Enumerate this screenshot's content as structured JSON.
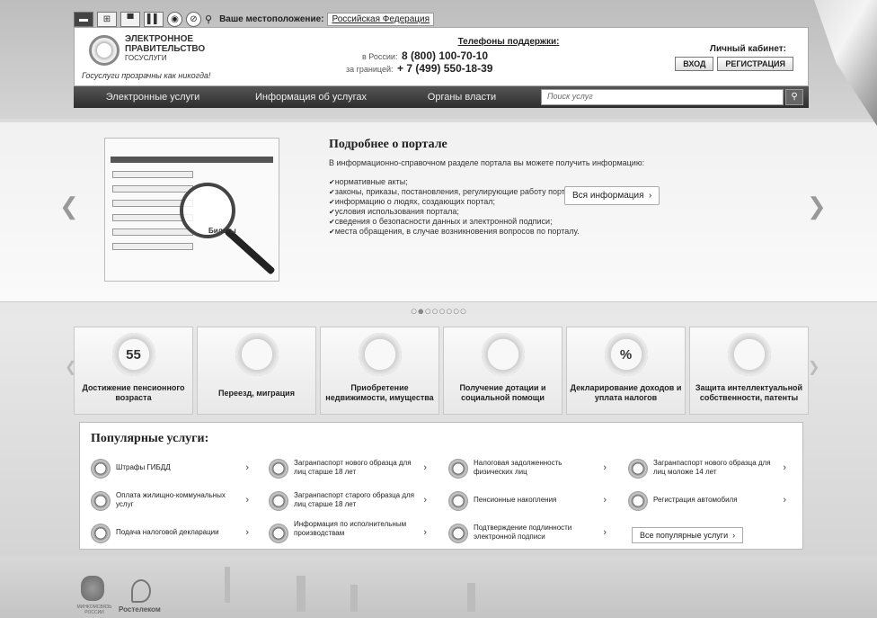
{
  "toolbar": {
    "location_label": "Ваше местоположение:",
    "location_value": "Российская Федерация"
  },
  "header": {
    "logo_line1": "ЭЛЕКТРОННОЕ",
    "logo_line2": "ПРАВИТЕЛЬСТВО",
    "logo_line3": "ГОСУСЛУГИ",
    "slogan": "Госуслуги прозрачны как никогда!",
    "support_title": "Телефоны поддержки:",
    "support_russia_label": "в России:",
    "support_russia_phone": "8 (800) 100-70-10",
    "support_abroad_label": "за границей:",
    "support_abroad_phone": "+ 7 (499) 550-18-39",
    "cabinet_label": "Личный кабинет:",
    "login_label": "ВХОД",
    "register_label": "РЕГИСТРАЦИЯ"
  },
  "nav": {
    "items": [
      "Электронные услуги",
      "Информация об услугах",
      "Органы власти"
    ],
    "search_placeholder": "Поиск услуг"
  },
  "promo": {
    "title": "Подробнее о портале",
    "intro": "В информационно-справочном разделе портала вы можете получить информацию:",
    "bullets": [
      "нормативные акты;",
      "законы, приказы, постановления, регулирующие работу портала;",
      "информацию о людях, создающих портал;",
      "условия использования портала;",
      "сведения о безопасности данных и электронной подписи;",
      "места обращения, в случае возникновения вопросов по порталу."
    ],
    "button_label": "Вся информация",
    "image_caption": "Билеты",
    "dots": "○●○○○○○○"
  },
  "categories": [
    {
      "label": "Достижение пенсионного возраста",
      "icon": "calendar-icon",
      "icon_text": "55"
    },
    {
      "label": "Переезд, миграция",
      "icon": "passport-icon",
      "icon_text": ""
    },
    {
      "label": "Приобретение недвижимости, имущества",
      "icon": "keys-icon",
      "icon_text": ""
    },
    {
      "label": "Получение дотации и социальной помощи",
      "icon": "lifebuoy-icon",
      "icon_text": ""
    },
    {
      "label": "Декларирование доходов и уплата налогов",
      "icon": "percent-icon",
      "icon_text": "%"
    },
    {
      "label": "Защита интеллектуальной собственности, патенты",
      "icon": "certificate-icon",
      "icon_text": ""
    }
  ],
  "popular": {
    "title": "Популярные услуги:",
    "services": [
      [
        "Штрафы ГИБДД",
        "Загранпаспорт нового образца для лиц старше 18 лет",
        "Налоговая задолженность физических лиц",
        "Загранпаспорт нового образца для лиц моложе 14 лет"
      ],
      [
        "Оплата жилищно-коммунальных услуг",
        "Загранпаспорт старого образца для лиц старше 18 лет",
        "Пенсионные накопления",
        "Регистрация автомобиля"
      ],
      [
        "Подача налоговой декларации",
        "Информация по исполнительным производствам",
        "Подтверждение подлинности электронной подписи"
      ]
    ],
    "all_label": "Все популярные услуги"
  },
  "footer": {
    "ministry_label": "МИНКОМСВЯЗЬ РОССИИ",
    "partner_label": "Ростелеком"
  },
  "colors": {
    "nav_bg": "#3a3a3a",
    "page_bg": "#d9d9d9"
  }
}
